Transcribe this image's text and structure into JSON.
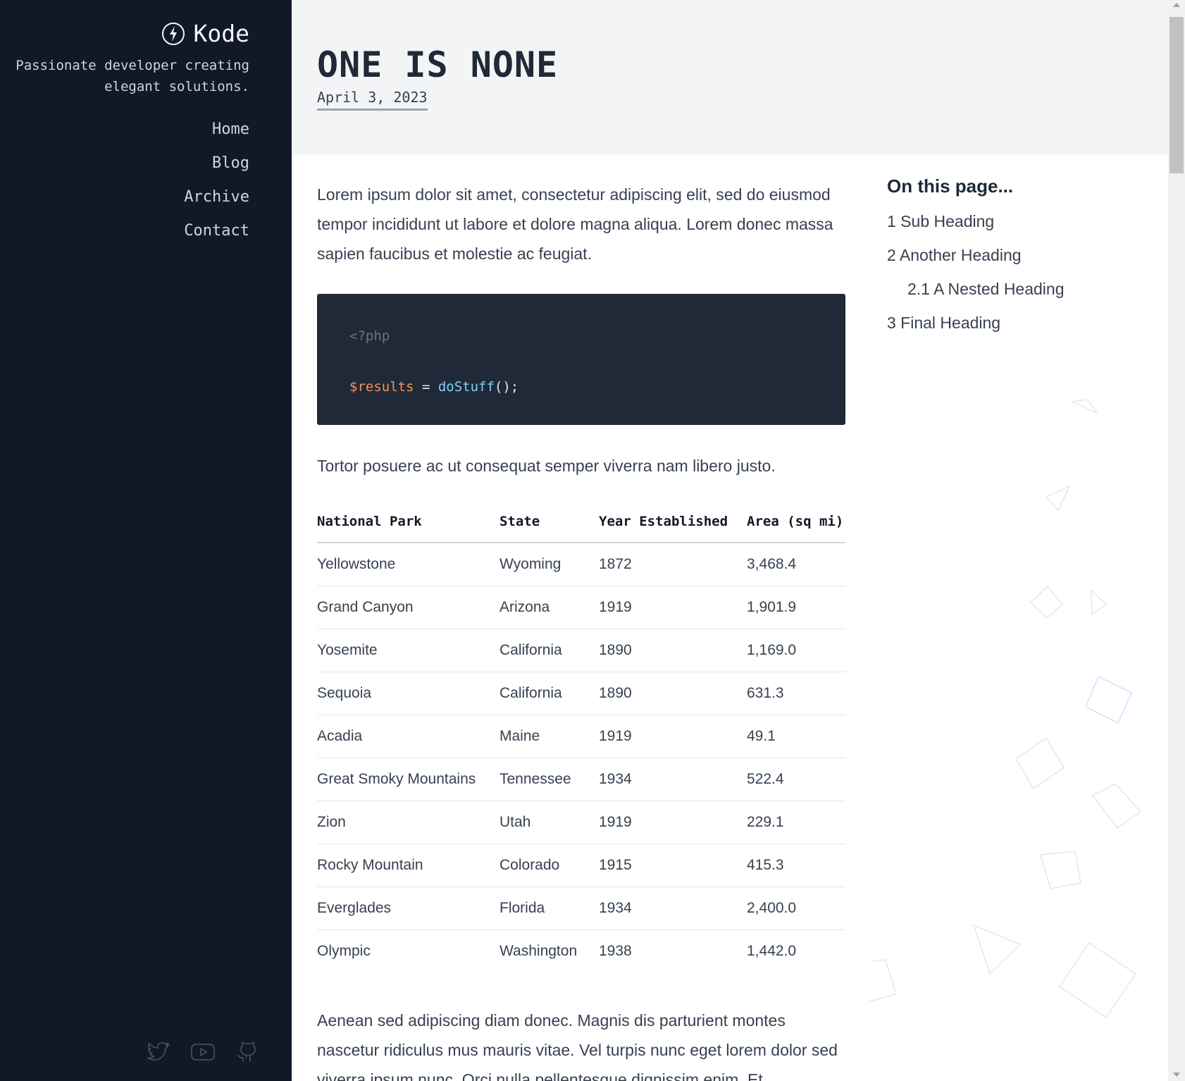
{
  "site": {
    "name": "Kode",
    "tagline": "Passionate developer creating elegant solutions.",
    "logo_icon": "bolt-circle-icon"
  },
  "nav": {
    "items": [
      {
        "label": "Home"
      },
      {
        "label": "Blog"
      },
      {
        "label": "Archive"
      },
      {
        "label": "Contact"
      }
    ]
  },
  "socials": {
    "items": [
      {
        "icon": "twitter-icon"
      },
      {
        "icon": "youtube-icon"
      },
      {
        "icon": "github-icon"
      }
    ]
  },
  "post": {
    "title": "ONE IS NONE",
    "date": "April 3, 2023",
    "para_1": "Lorem ipsum dolor sit amet, consectetur adipiscing elit, sed do eiusmod tempor incididunt ut labore et dolore magna aliqua. Lorem donec massa sapien faucibus et molestie ac feugiat.",
    "code": {
      "line_1": "<?php",
      "var": "$results",
      "op": " = ",
      "fn": "doStuff",
      "punc": "();"
    },
    "para_2": "Tortor posuere ac ut consequat semper viverra nam libero justo.",
    "para_3": "Aenean sed adipiscing diam donec. Magnis dis parturient montes nascetur ridiculus mus mauris vitae. Vel turpis nunc eget lorem dolor sed viverra ipsum nunc. Orci nulla pellentesque dignissim enim. Et"
  },
  "table": {
    "headers": [
      "National Park",
      "State",
      "Year Established",
      "Area (sq mi)"
    ],
    "rows": [
      [
        "Yellowstone",
        "Wyoming",
        "1872",
        "3,468.4"
      ],
      [
        "Grand Canyon",
        "Arizona",
        "1919",
        "1,901.9"
      ],
      [
        "Yosemite",
        "California",
        "1890",
        "1,169.0"
      ],
      [
        "Sequoia",
        "California",
        "1890",
        "631.3"
      ],
      [
        "Acadia",
        "Maine",
        "1919",
        "49.1"
      ],
      [
        "Great Smoky Mountains",
        "Tennessee",
        "1934",
        "522.4"
      ],
      [
        "Zion",
        "Utah",
        "1919",
        "229.1"
      ],
      [
        "Rocky Mountain",
        "Colorado",
        "1915",
        "415.3"
      ],
      [
        "Everglades",
        "Florida",
        "1934",
        "2,400.0"
      ],
      [
        "Olympic",
        "Washington",
        "1938",
        "1,442.0"
      ]
    ]
  },
  "toc": {
    "title": "On this page...",
    "items": [
      {
        "label": "1 Sub Heading",
        "nested": false
      },
      {
        "label": "2 Another Heading",
        "nested": false
      },
      {
        "label": "2.1 A Nested Heading",
        "nested": true
      },
      {
        "label": "3 Final Heading",
        "nested": false
      }
    ]
  },
  "colors": {
    "sidebar_bg": "#111827",
    "header_bg": "#f3f4f6",
    "code_bg": "#1f2937",
    "accent_shape": "#d8b4fe"
  }
}
